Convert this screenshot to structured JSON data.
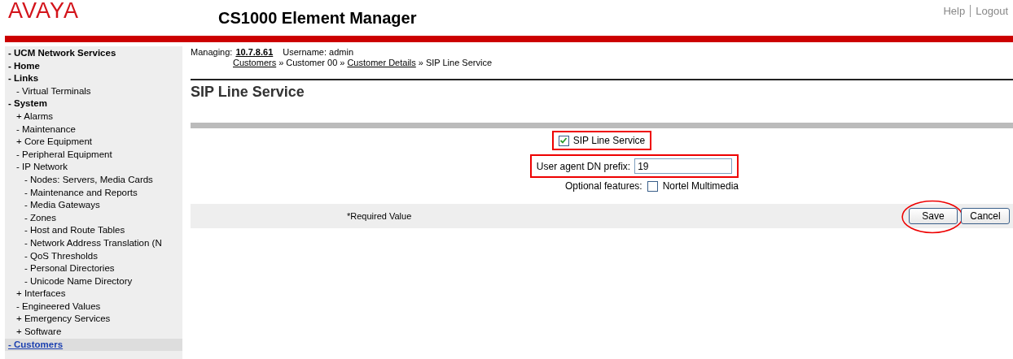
{
  "header": {
    "logo": "AVAYA",
    "title": "CS1000 Element Manager",
    "links": [
      "Help",
      "Logout"
    ]
  },
  "sidebar": {
    "items": [
      {
        "sign": "-",
        "label": "UCM Network Services",
        "selected": false
      },
      {
        "sign": "-",
        "label": "Home",
        "selected": false
      },
      {
        "sign": "-",
        "label": "Links",
        "selected": false,
        "children": [
          {
            "sign": "-",
            "label": "Virtual Terminals",
            "selected": false
          }
        ]
      },
      {
        "sign": "-",
        "label": "System",
        "selected": false,
        "children": [
          {
            "sign": "+",
            "label": "Alarms",
            "selected": false
          },
          {
            "sign": "-",
            "label": "Maintenance",
            "selected": false
          },
          {
            "sign": "+",
            "label": "Core Equipment",
            "selected": false
          },
          {
            "sign": "-",
            "label": "Peripheral Equipment",
            "selected": false
          },
          {
            "sign": "-",
            "label": "IP Network",
            "selected": false,
            "children": [
              {
                "sign": "-",
                "label": "Nodes: Servers, Media Cards",
                "selected": false
              },
              {
                "sign": "-",
                "label": "Maintenance and Reports",
                "selected": false
              },
              {
                "sign": "-",
                "label": "Media Gateways",
                "selected": false
              },
              {
                "sign": "-",
                "label": "Zones",
                "selected": false
              },
              {
                "sign": "-",
                "label": "Host and Route Tables",
                "selected": false
              },
              {
                "sign": "-",
                "label": "Network Address Translation (N",
                "selected": false
              },
              {
                "sign": "-",
                "label": "QoS Thresholds",
                "selected": false
              },
              {
                "sign": "-",
                "label": "Personal Directories",
                "selected": false
              },
              {
                "sign": "-",
                "label": "Unicode Name Directory",
                "selected": false
              }
            ]
          },
          {
            "sign": "+",
            "label": "Interfaces",
            "selected": false
          },
          {
            "sign": "-",
            "label": "Engineered Values",
            "selected": false
          },
          {
            "sign": "+",
            "label": "Emergency Services",
            "selected": false
          },
          {
            "sign": "+",
            "label": "Software",
            "selected": false
          }
        ]
      },
      {
        "sign": "-",
        "label": "Customers",
        "selected": true
      }
    ]
  },
  "context": {
    "managing_label": "Managing:",
    "managing_value": "10.7.8.61",
    "username": "Username: admin"
  },
  "breadcrumb": [
    {
      "label": "Customers",
      "link": true
    },
    {
      "label": "Customer 00",
      "link": false
    },
    {
      "label": "Customer Details",
      "link": true
    },
    {
      "label": "SIP Line Service",
      "link": false
    }
  ],
  "breadcrumb_separator": "»",
  "page_title": "SIP Line Service",
  "form": {
    "sip_line_service": {
      "label": "SIP Line Service",
      "checked": true,
      "highlighted": true
    },
    "dn_prefix": {
      "label": "User agent DN prefix:",
      "value": "19",
      "highlighted": true
    },
    "optional_features": {
      "label": "Optional features:",
      "option": "Nortel Multimedia",
      "checked": false
    }
  },
  "footer": {
    "note": "*Required Value",
    "buttons": [
      {
        "label": "Save",
        "circled": true
      },
      {
        "label": "Cancel",
        "circled": false
      }
    ]
  }
}
